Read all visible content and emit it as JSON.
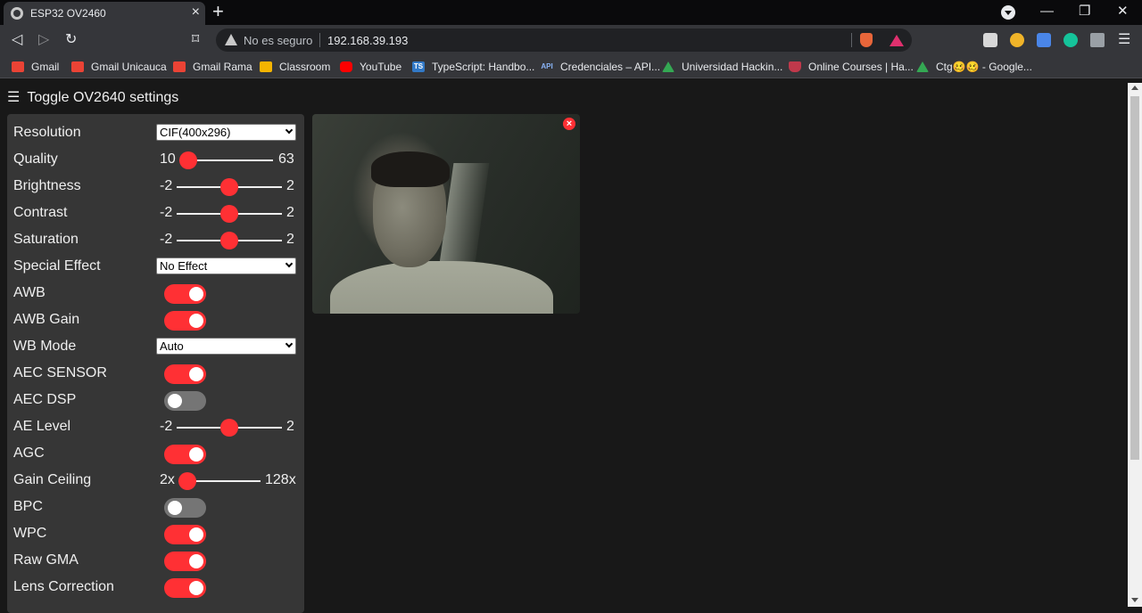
{
  "browser": {
    "tab_title": "ESP32 OV2460",
    "tab_close": "×",
    "new_tab": "+",
    "security_text": "No es seguro",
    "url": "192.168.39.193",
    "window_controls": {
      "minimize": "—",
      "restore": "❐",
      "close": "✕"
    },
    "icons": [
      "back-icon",
      "forward-icon",
      "reload-icon",
      "bookmark-icon",
      "warning-icon",
      "brave-shield-icon",
      "rewards-icon",
      "reader-icon",
      "thumbs-up-icon",
      "translate-icon",
      "grammarly-icon",
      "extensions-icon",
      "menu-icon"
    ]
  },
  "bookmarks": [
    {
      "label": "Gmail",
      "icon": "gmail-icon",
      "color": "#ea4335"
    },
    {
      "label": "Gmail Unicauca",
      "icon": "gmail-icon",
      "color": "#ea4335"
    },
    {
      "label": "Gmail Rama",
      "icon": "gmail-icon",
      "color": "#ea4335"
    },
    {
      "label": "Classroom",
      "icon": "classroom-icon",
      "color": "#f4b400"
    },
    {
      "label": "YouTube",
      "icon": "youtube-icon",
      "color": "#ff0000"
    },
    {
      "label": "TypeScript: Handbo...",
      "icon": "typescript-icon",
      "color": "#3178c6",
      "icon_text": "TS"
    },
    {
      "label": "Credenciales – API...",
      "icon": "api-icon",
      "color": "#35363a",
      "icon_text": "API"
    },
    {
      "label": "Universidad Hackin...",
      "icon": "drive-icon",
      "color": "#34a853"
    },
    {
      "label": "Online Courses | Ha...",
      "icon": "harvard-icon",
      "color": "#c0394b"
    },
    {
      "label": "Ctg🥴🥴 - Google...",
      "icon": "drive-icon",
      "color": "#34a853"
    }
  ],
  "page": {
    "toggle_label": "Toggle OV2640 settings",
    "hamburger": "☰",
    "close_stream": "×",
    "accent_color": "#ff3034"
  },
  "settings": {
    "resolution": {
      "label": "Resolution",
      "value": "CIF(400x296)"
    },
    "quality": {
      "label": "Quality",
      "min": "10",
      "max": "63",
      "value": 10
    },
    "brightness": {
      "label": "Brightness",
      "min": "-2",
      "max": "2",
      "value": 0
    },
    "contrast": {
      "label": "Contrast",
      "min": "-2",
      "max": "2",
      "value": 0
    },
    "saturation": {
      "label": "Saturation",
      "min": "-2",
      "max": "2",
      "value": 0
    },
    "special_effect": {
      "label": "Special Effect",
      "value": "No Effect"
    },
    "awb": {
      "label": "AWB",
      "on": true
    },
    "awb_gain": {
      "label": "AWB Gain",
      "on": true
    },
    "wb_mode": {
      "label": "WB Mode",
      "value": "Auto"
    },
    "aec_sensor": {
      "label": "AEC SENSOR",
      "on": true
    },
    "aec_dsp": {
      "label": "AEC DSP",
      "on": false
    },
    "ae_level": {
      "label": "AE Level",
      "min": "-2",
      "max": "2",
      "value": 0
    },
    "agc": {
      "label": "AGC",
      "on": true
    },
    "gain_ceiling": {
      "label": "Gain Ceiling",
      "min": "2x",
      "max": "128x",
      "value": "2x"
    },
    "bpc": {
      "label": "BPC",
      "on": false
    },
    "wpc": {
      "label": "WPC",
      "on": true
    },
    "raw_gma": {
      "label": "Raw GMA",
      "on": true
    },
    "lens_correction": {
      "label": "Lens Correction",
      "on": true
    }
  }
}
